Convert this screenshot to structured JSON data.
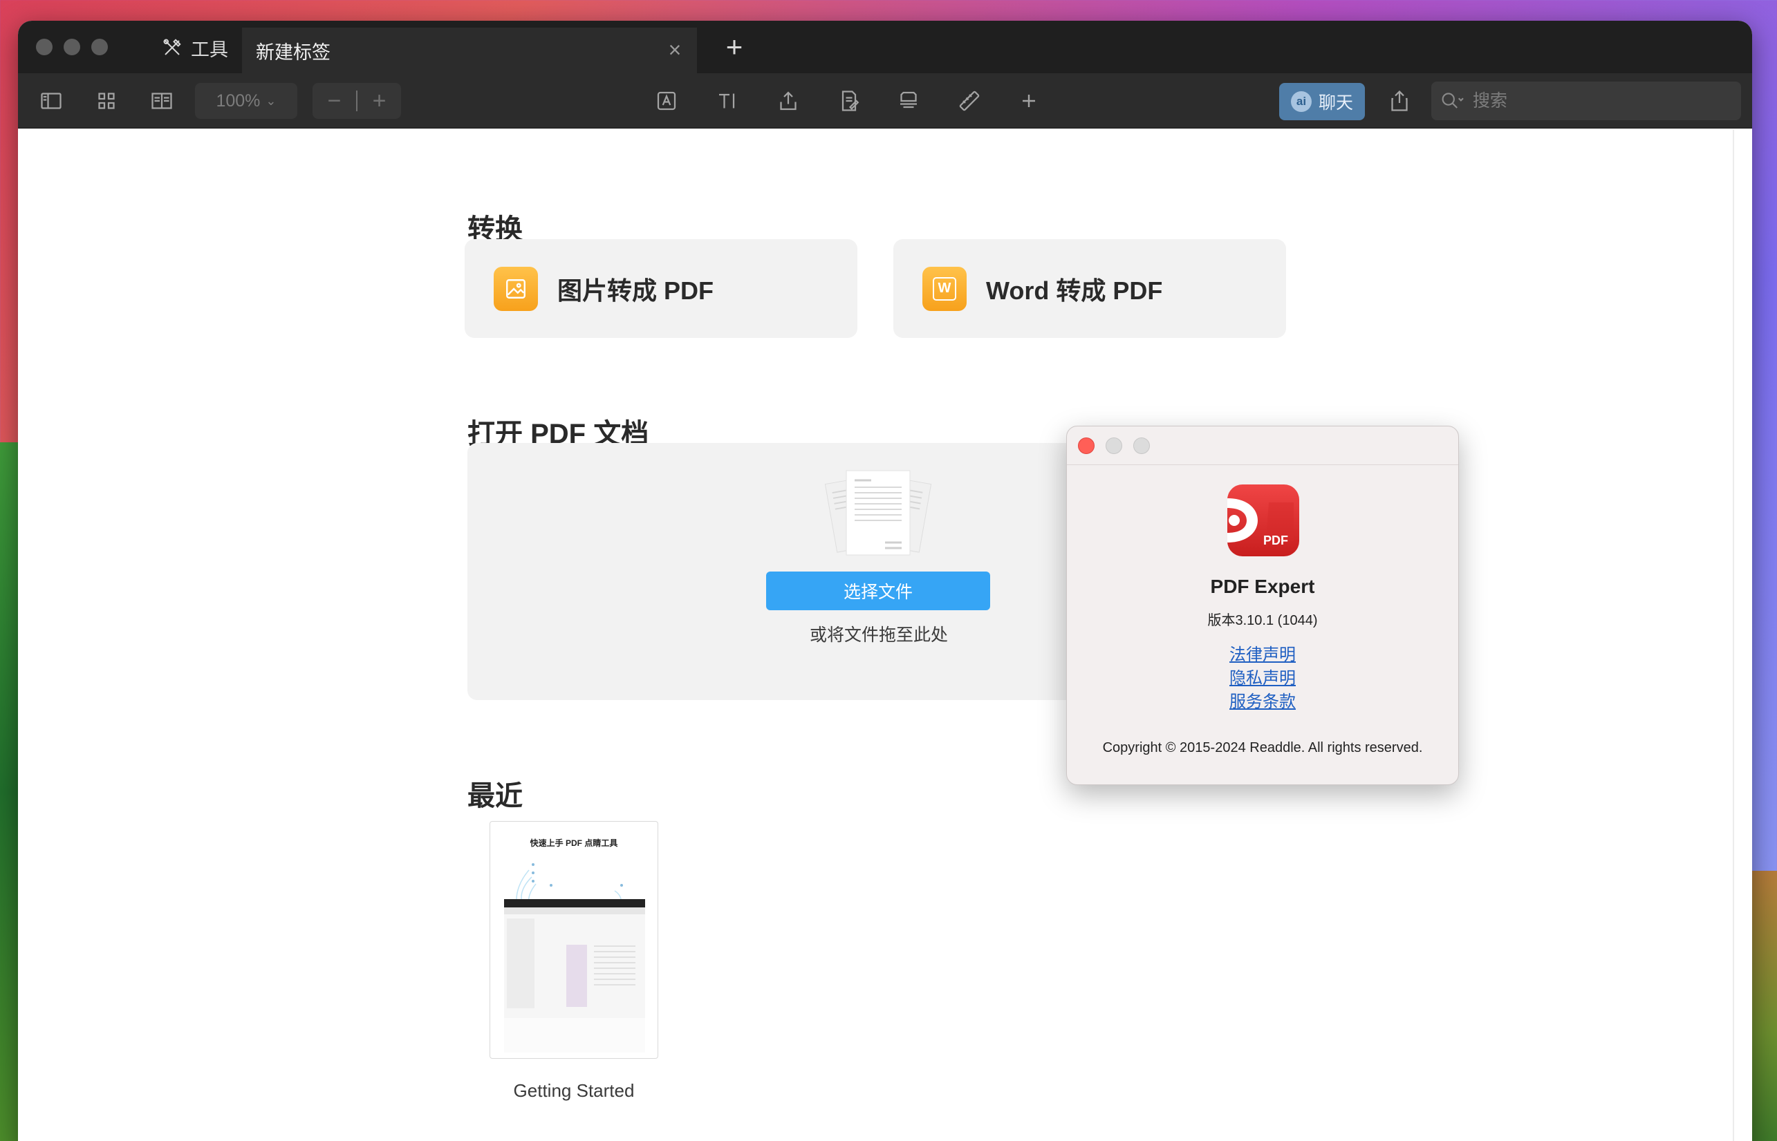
{
  "window": {
    "tabs": {
      "tools_label": "工具",
      "active_label": "新建标签",
      "close_glyph": "×",
      "add_glyph": "+"
    }
  },
  "toolbar": {
    "zoom_value": "100%",
    "zoom_minus": "−",
    "zoom_plus": "+",
    "chat": {
      "badge": "ai",
      "label": "聊天"
    },
    "search": {
      "placeholder": "搜索",
      "value": ""
    },
    "icons": [
      "sidebar-icon",
      "grid-icon",
      "reader-icon",
      "text-box-icon",
      "text-cursor-icon",
      "export-icon",
      "annotate-icon",
      "stamp-icon",
      "ruler-icon",
      "add-icon",
      "share-icon",
      "search-icon"
    ]
  },
  "main": {
    "convert": {
      "title": "转换",
      "cards": [
        {
          "label": "图片转成 PDF",
          "icon": "image-icon",
          "icon_text": ""
        },
        {
          "label": "Word 转成 PDF",
          "icon": "word-icon",
          "icon_text": "W"
        }
      ]
    },
    "open": {
      "title": "打开 PDF 文档",
      "button": "选择文件",
      "hint": "或将文件拖至此处"
    },
    "recent": {
      "title": "最近",
      "items": [
        {
          "name": "Getting Started",
          "thumb_title": "快速上手 PDF 点睛工具"
        }
      ]
    }
  },
  "about": {
    "app_name": "PDF Expert",
    "version": "版本3.10.1 (1044)",
    "logo_text": "PDF",
    "links": [
      "法律声明",
      "隐私声明",
      "服务条款"
    ],
    "copyright": "Copyright © 2015-2024 Readdle. All rights reserved."
  },
  "colors": {
    "accent_blue": "#36a5f5",
    "chat_blue": "#4f7da8",
    "convert_orange": "#f7a11c",
    "close_red": "#ff5f57",
    "link_blue": "#1f5fc2"
  }
}
